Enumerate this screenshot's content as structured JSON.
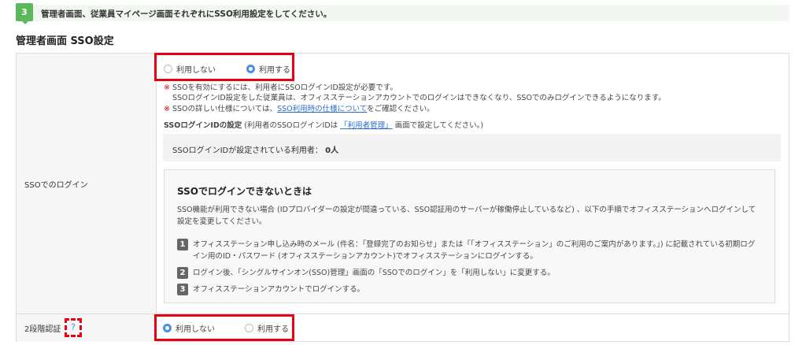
{
  "banner": {
    "step": "3",
    "text": "管理者画面、従業員マイページ画面それぞれにSSO利用設定をしてください。"
  },
  "heading": "管理者画面 SSO設定",
  "sso_login": {
    "label": "SSOでのログイン",
    "options": [
      {
        "label": "利用しない",
        "selected": false
      },
      {
        "label": "利用する",
        "selected": true
      }
    ],
    "note_mark": "※",
    "note1": "SSOを有効にするには、利用者にSSOログインID設定が必要です。",
    "note1b": "SSOログインID設定をした従業員は、オフィスステーションアカウントでのログインはできなくなり、SSOでのみログインできるようになります。",
    "note2_pre": "SSOの詳しい仕様については、",
    "note2_link": "SSO利用時の仕様について",
    "note2_post": "をご確認ください。",
    "id_title": "SSOログインIDの設定",
    "id_desc_pre": " (利用者のSSOログインIDは ",
    "id_desc_link": "「利用者管理」",
    "id_desc_post": " 画面で設定してください。)",
    "count_label": "SSOログインIDが設定されている利用者：",
    "count_value": "0人",
    "help_box": {
      "title": "SSOでログインできないときは",
      "desc": "SSO機能が利用できない場合 (IDプロバイダーの設定が間違っている、SSO認証用のサーバーが稼働停止しているなど) 、以下の手順でオフィスステーションへログインして設定を変更してください。",
      "steps": [
        {
          "num": "1",
          "text": "オフィスステーション申し込み時のメール (件名：「登録完了のお知らせ」または「「オフィスステーション」のご利用のご案内があります。」) に記載されている初期ログイン用のID・パスワード (オフィスステーションアカウント)でオフィスステーションにログインする。"
        },
        {
          "num": "2",
          "text": "ログイン後、「シングルサインオン(SSO)管理」画面の「SSOでのログイン」を「利用しない」に変更する。"
        },
        {
          "num": "3",
          "text": "オフィスステーションアカウントでログインする。"
        }
      ]
    }
  },
  "two_factor": {
    "label": "2段階認証",
    "help": "?",
    "options": [
      {
        "label": "利用しない",
        "selected": true
      },
      {
        "label": "利用する",
        "selected": false
      }
    ]
  },
  "colors": {
    "accent": "#4a8fe7",
    "highlight": "#e60012",
    "step": "#5cb85c"
  }
}
